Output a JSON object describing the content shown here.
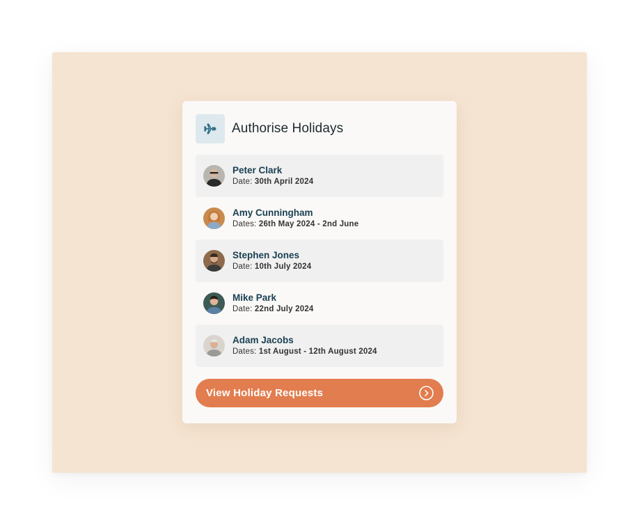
{
  "card": {
    "title": "Authorise Holidays",
    "header_icon": "airplane-icon"
  },
  "requests": [
    {
      "name": "Peter Clark",
      "date_label": "Date:",
      "date_value": "30th April 2024"
    },
    {
      "name": "Amy Cunningham",
      "date_label": "Dates:",
      "date_value": "26th May 2024 - 2nd June"
    },
    {
      "name": "Stephen Jones",
      "date_label": "Date:",
      "date_value": "10th July 2024"
    },
    {
      "name": "Mike Park",
      "date_label": "Date:",
      "date_value": "22nd July 2024"
    },
    {
      "name": "Adam Jacobs",
      "date_label": "Dates:",
      "date_value": "1st August - 12th August 2024"
    }
  ],
  "cta": {
    "label": "View Holiday Requests",
    "icon": "chevron-right-circle-icon"
  },
  "colors": {
    "backdrop": "#f5e4d2",
    "card": "#faf9f7",
    "accent": "#e27d4f",
    "name_text": "#1b4153",
    "icon_box": "#dde9ee",
    "icon": "#2f6f86"
  }
}
